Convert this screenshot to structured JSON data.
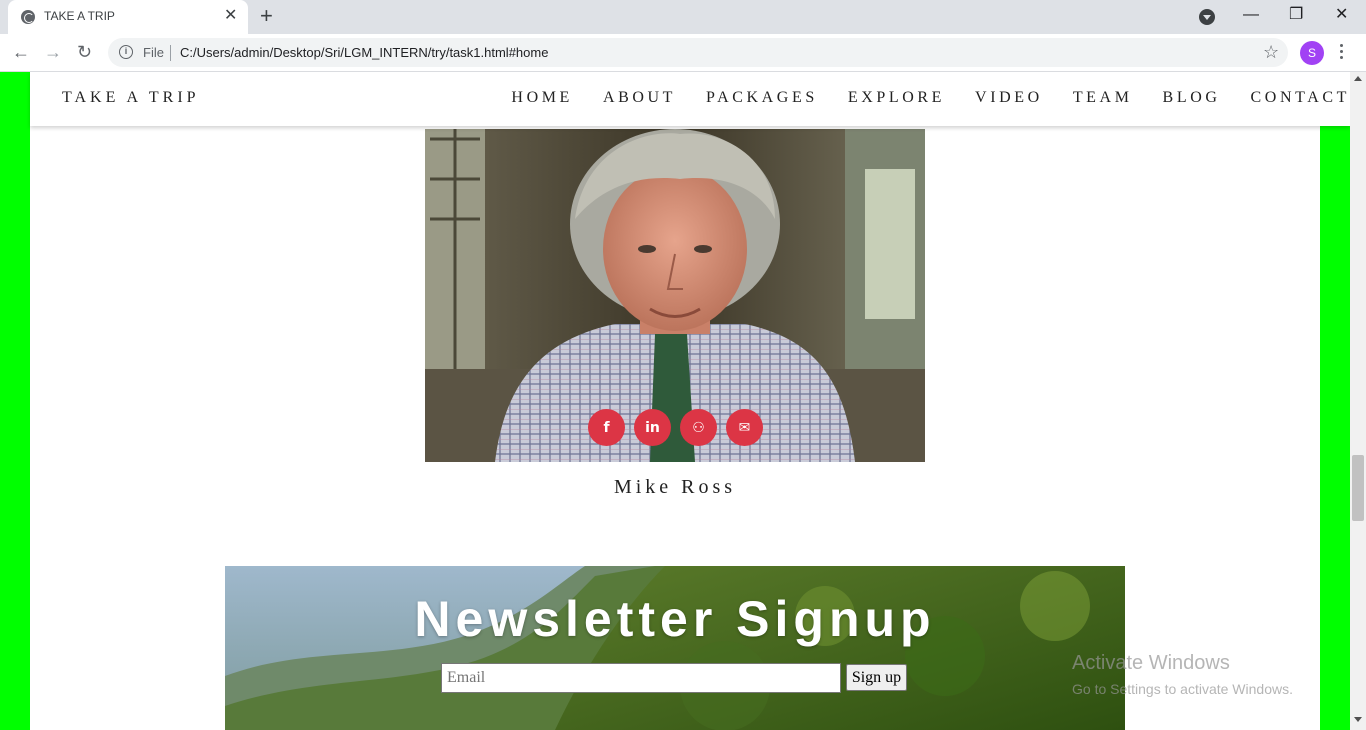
{
  "browser": {
    "tab_title": "TAKE A TRIP",
    "tab_close": "✕",
    "new_tab": "+",
    "window_min": "—",
    "window_max": "❐",
    "window_close": "✕",
    "back": "←",
    "forward": "→",
    "reload": "↻",
    "info_glyph": "i",
    "file_label": "File",
    "url": "C:/Users/admin/Desktop/Sri/LGM_INTERN/try/task1.html#home",
    "star": "☆",
    "profile_initial": "S"
  },
  "site": {
    "brand": "TAKE A TRIP",
    "nav": [
      "HOME",
      "ABOUT",
      "PACKAGES",
      "EXPLORE",
      "VIDEO",
      "TEAM",
      "BLOG",
      "CONTACT"
    ]
  },
  "team_member": {
    "name": "Mike Ross",
    "socials": [
      {
        "icon": "facebook-icon",
        "glyph": "f"
      },
      {
        "icon": "linkedin-icon",
        "glyph": "in"
      },
      {
        "icon": "github-icon",
        "glyph": "⚇"
      },
      {
        "icon": "envelope-icon",
        "glyph": "✉"
      }
    ]
  },
  "newsletter": {
    "title": "Newsletter Signup",
    "email_placeholder": "Email",
    "button_label": "Sign up"
  },
  "watermark": {
    "title": "Activate Windows",
    "subtitle": "Go to Settings to activate Windows."
  },
  "colors": {
    "side_bands": "#00ff00",
    "social_buttons": "#dc3545"
  }
}
